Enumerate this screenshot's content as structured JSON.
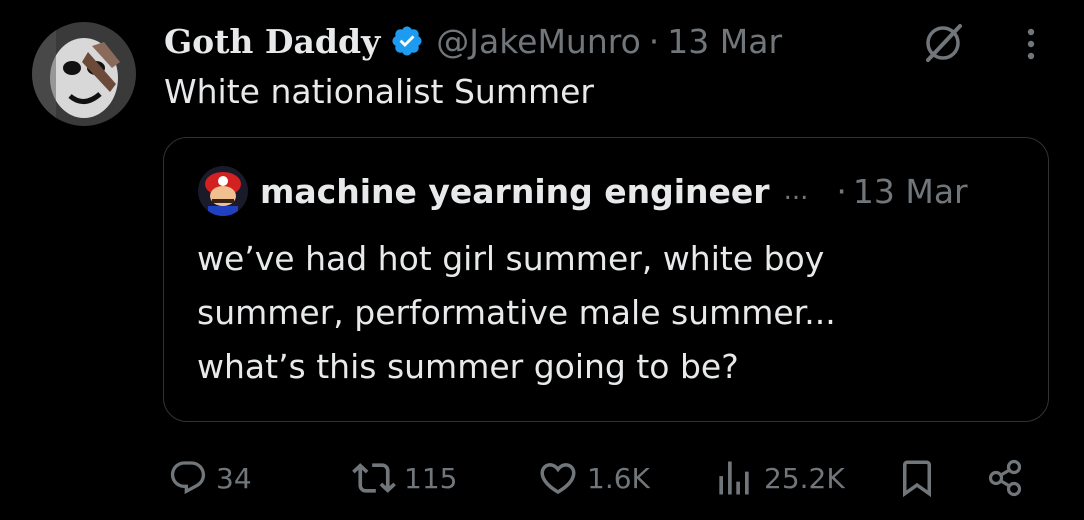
{
  "tweet": {
    "display_name": "Goth Daddy",
    "verified": true,
    "handle": "@JakeMunro",
    "separator": "·",
    "date": "13 Mar",
    "text": "White nationalist Summer"
  },
  "quote": {
    "display_name": "machine yearning engineer",
    "ellipsis": "...",
    "separator": "·",
    "date": "13 Mar",
    "text": "we’ve had hot girl summer, white boy\nsummer, performative male summer...\nwhat’s this summer going to be?"
  },
  "actions": {
    "replies": "34",
    "reposts": "115",
    "likes": "1.6K",
    "views": "25.2K"
  },
  "icons": {
    "verified": "verified-badge-icon",
    "grok": "grok-icon",
    "more": "more-options-icon",
    "reply": "reply-icon",
    "repost": "repost-icon",
    "like": "heart-icon",
    "views": "analytics-icon",
    "bookmark": "bookmark-icon",
    "share": "share-icon"
  },
  "colors": {
    "background": "#000000",
    "text_primary": "#e7e9ea",
    "text_secondary": "#71767b",
    "verified_blue": "#1d9bf0",
    "border": "#2f3336"
  }
}
